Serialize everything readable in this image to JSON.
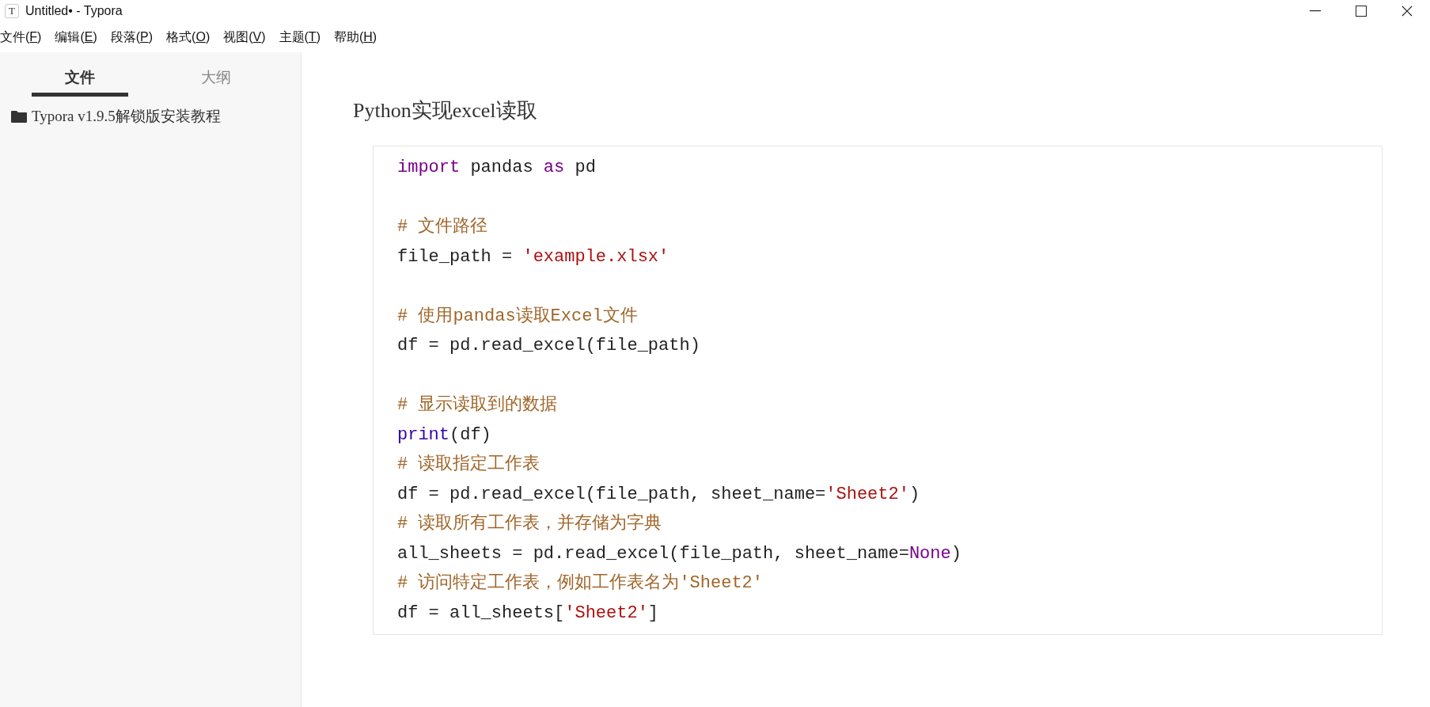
{
  "window": {
    "title": "Untitled• - Typora",
    "app_icon": "T"
  },
  "menu": [
    {
      "prefix": "文件(",
      "key": "F",
      "suffix": ")"
    },
    {
      "prefix": "编辑(",
      "key": "E",
      "suffix": ")"
    },
    {
      "prefix": "段落(",
      "key": "P",
      "suffix": ")"
    },
    {
      "prefix": "格式(",
      "key": "O",
      "suffix": ")"
    },
    {
      "prefix": "视图(",
      "key": "V",
      "suffix": ")"
    },
    {
      "prefix": "主题(",
      "key": "T",
      "suffix": ")"
    },
    {
      "prefix": "帮助(",
      "key": "H",
      "suffix": ")"
    }
  ],
  "sidebar": {
    "tabs": [
      {
        "label": "文件",
        "selected": true
      },
      {
        "label": "大纲",
        "selected": false
      }
    ],
    "items": [
      {
        "label": "Typora v1.9.5解锁版安装教程"
      }
    ]
  },
  "document": {
    "heading": "Python实现excel读取",
    "code_lines": [
      {
        "kind": "code",
        "tokens": [
          {
            "kind": "keyword",
            "text": "import"
          },
          {
            "kind": "plain",
            "text": " pandas "
          },
          {
            "kind": "keyword",
            "text": "as"
          },
          {
            "kind": "plain",
            "text": " pd"
          }
        ]
      },
      {
        "kind": "blank"
      },
      {
        "kind": "code",
        "tokens": [
          {
            "kind": "comment",
            "text": "# 文件路径"
          }
        ]
      },
      {
        "kind": "code",
        "tokens": [
          {
            "kind": "plain",
            "text": "file_path = "
          },
          {
            "kind": "string",
            "text": "'example.xlsx'"
          }
        ]
      },
      {
        "kind": "blank"
      },
      {
        "kind": "code",
        "tokens": [
          {
            "kind": "comment",
            "text": "# 使用pandas读取Excel文件"
          }
        ]
      },
      {
        "kind": "code",
        "tokens": [
          {
            "kind": "plain",
            "text": "df = pd.read_excel(file_path)"
          }
        ]
      },
      {
        "kind": "blank"
      },
      {
        "kind": "code",
        "tokens": [
          {
            "kind": "comment",
            "text": "# 显示读取到的数据"
          }
        ]
      },
      {
        "kind": "code",
        "tokens": [
          {
            "kind": "builtin",
            "text": "print"
          },
          {
            "kind": "plain",
            "text": "(df)"
          }
        ]
      },
      {
        "kind": "code",
        "tokens": [
          {
            "kind": "comment",
            "text": "# 读取指定工作表"
          }
        ]
      },
      {
        "kind": "code",
        "tokens": [
          {
            "kind": "plain",
            "text": "df = pd.read_excel(file_path, sheet_name="
          },
          {
            "kind": "string",
            "text": "'Sheet2'"
          },
          {
            "kind": "plain",
            "text": ")"
          }
        ]
      },
      {
        "kind": "code",
        "tokens": [
          {
            "kind": "comment",
            "text": "# 读取所有工作表，并存储为字典"
          }
        ]
      },
      {
        "kind": "code",
        "tokens": [
          {
            "kind": "plain",
            "text": "all_sheets = pd.read_excel(file_path, sheet_name="
          },
          {
            "kind": "keyword",
            "text": "None"
          },
          {
            "kind": "plain",
            "text": ")"
          }
        ]
      },
      {
        "kind": "code",
        "tokens": [
          {
            "kind": "comment",
            "text": "# 访问特定工作表，例如工作表名为'Sheet2'"
          }
        ]
      },
      {
        "kind": "code",
        "tokens": [
          {
            "kind": "plain",
            "text": "df = all_sheets["
          },
          {
            "kind": "string",
            "text": "'Sheet2'"
          },
          {
            "kind": "plain",
            "text": "]"
          }
        ]
      }
    ]
  }
}
